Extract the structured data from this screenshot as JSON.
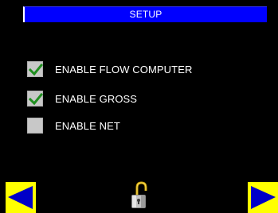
{
  "header": {
    "title": "SETUP"
  },
  "options": [
    {
      "label": "ENABLE FLOW COMPUTER",
      "checked": true
    },
    {
      "label": "ENABLE GROSS",
      "checked": true
    },
    {
      "label": "ENABLE NET",
      "checked": false
    }
  ],
  "footer": {
    "prev_icon": "arrow-left-icon",
    "lock_icon": "unlocked-padlock-icon",
    "next_icon": "arrow-right-icon"
  },
  "colors": {
    "background": "#000000",
    "title_bar": "#0000ff",
    "checkbox": "#c8c8c8",
    "checkmark": "#1f8f1f",
    "nav_button": "#ffff00",
    "nav_arrow": "#0000c8"
  }
}
